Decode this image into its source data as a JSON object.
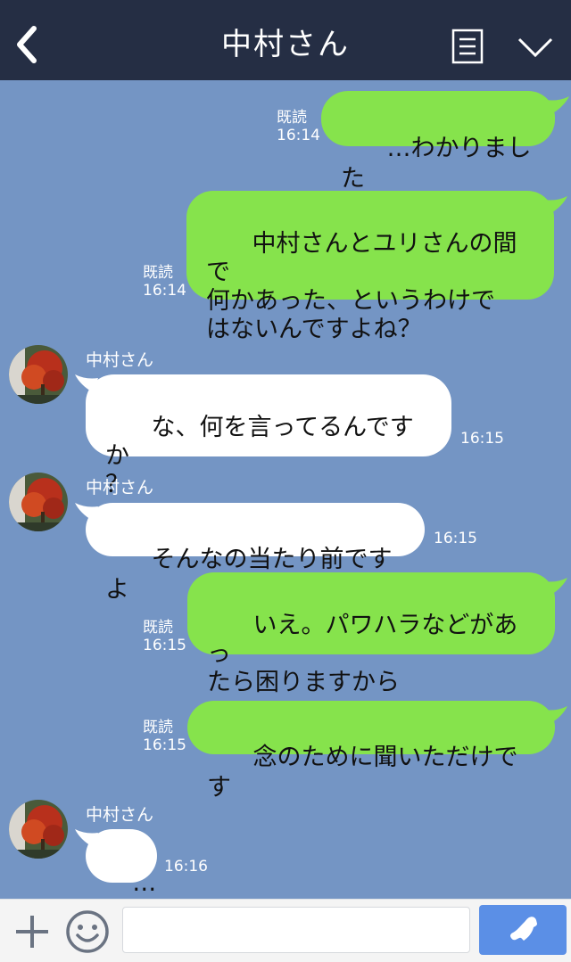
{
  "header": {
    "title": "中村さん",
    "icons": [
      "back-chevron-icon",
      "menu-list-icon",
      "chevron-down-icon"
    ]
  },
  "messages": [
    {
      "side": "out",
      "text": "…わかりました",
      "read": "既読",
      "time": "16:14"
    },
    {
      "side": "out",
      "text": "中村さんとユリさんの間で\n何かあった、というわけで\nはないんですよね？",
      "read": "既読",
      "time": "16:14"
    },
    {
      "side": "in",
      "sender": "中村さん",
      "text": "な、何を言ってるんですか\n？",
      "time": "16:15"
    },
    {
      "side": "in",
      "sender": "中村さん",
      "text": "そんなの当たり前ですよ",
      "time": "16:15"
    },
    {
      "side": "out",
      "text": "いえ。パワハラなどがあっ\nたら困りますから",
      "read": "既読",
      "time": "16:15"
    },
    {
      "side": "out",
      "text": "念のために聞いただけです",
      "read": "既読",
      "time": "16:15"
    },
    {
      "side": "in",
      "sender": "中村さん",
      "text": "…",
      "time": "16:16"
    }
  ],
  "footer": {
    "input_value": "",
    "input_placeholder": "",
    "icons": [
      "plus-icon",
      "smile-icon",
      "phone-icon"
    ]
  },
  "colors": {
    "header_bg": "#252e44",
    "chat_bg": "#7495c4",
    "outgoing_bubble": "#86e34c",
    "incoming_bubble": "#ffffff",
    "call_button": "#5b8fe6"
  }
}
